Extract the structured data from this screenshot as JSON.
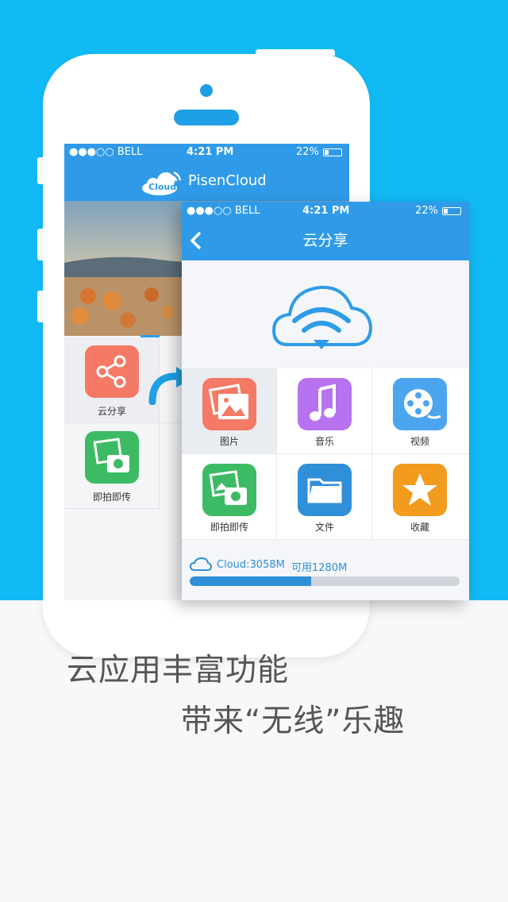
{
  "back_phone": {
    "status": {
      "carrier": "●●●○○ BELL",
      "time": "4:21 PM",
      "battery": "22%"
    },
    "logo_text": "Cloud",
    "app_name": "PisenCloud",
    "grid": [
      {
        "label": "云分享",
        "icon": "share-icon",
        "color": "#f47a66"
      },
      {
        "label": "即拍即传",
        "icon": "photo-camera-icon",
        "color": "#3dbb64"
      }
    ]
  },
  "front_screen": {
    "status": {
      "carrier": "●●●○○ BELL",
      "time": "4:21 PM",
      "battery": "22%"
    },
    "title": "云分享",
    "grid": [
      {
        "label": "图片",
        "icon": "image-icon",
        "color": "#f47a66"
      },
      {
        "label": "音乐",
        "icon": "music-note-icon",
        "color": "#b772f0"
      },
      {
        "label": "视频",
        "icon": "film-reel-icon",
        "color": "#4ba5ef"
      },
      {
        "label": "即拍即传",
        "icon": "photo-camera-icon",
        "color": "#3dbb64"
      },
      {
        "label": "文件",
        "icon": "folder-icon",
        "color": "#2f8fd8"
      },
      {
        "label": "收藏",
        "icon": "star-icon",
        "color": "#f39b1d"
      }
    ],
    "storage": {
      "used_label": "Cloud:3058M",
      "available_label": "可用1280M",
      "used_fraction": 0.45
    }
  },
  "slogan": {
    "line1": "云应用丰富功能",
    "line2": "带来“无线”乐趣"
  },
  "colors": {
    "background_blue": "#12baf5",
    "app_blue": "#2f9be8"
  }
}
